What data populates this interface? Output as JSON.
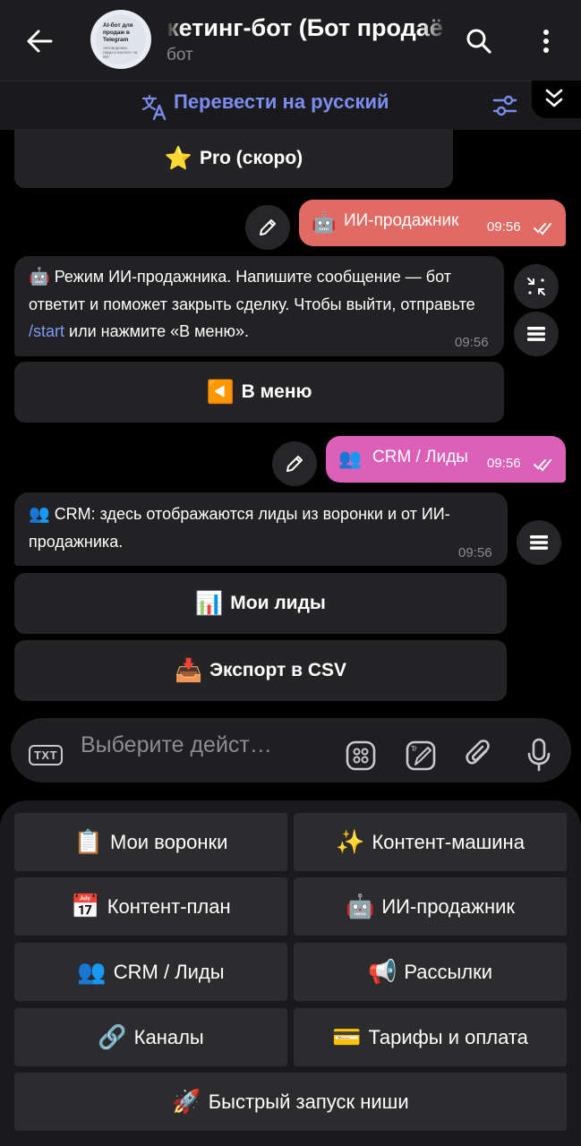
{
  "header": {
    "title": "кетинг-бот (Бот продаё",
    "subtitle": "бот",
    "avatar_text_1": "AI-бот для продаж в Telegram",
    "avatar_text_2": "Автоворонки, лиды и контент на ИИ"
  },
  "translate_bar": {
    "label": "Перевести на русский"
  },
  "messages": {
    "pro_button": {
      "emoji": "⭐",
      "label": "Pro (скоро)"
    },
    "out1": {
      "emoji": "🤖",
      "text": "ИИ-продажник",
      "time": "09:56"
    },
    "in1": {
      "emoji": "🤖",
      "text_before": "Режим ИИ-продажника. Напишите сообщение — бот ответит и поможет закрыть сделку. Чтобы выйти, отправьте ",
      "command": "/start",
      "text_after": " или нажмите «В меню».",
      "time": "09:56"
    },
    "menu_button": {
      "emoji": "◀️",
      "label": "В меню"
    },
    "out2": {
      "emoji": "👥",
      "text": "CRM / Лиды",
      "time": "09:56"
    },
    "in2": {
      "emoji": "👥",
      "text": "CRM: здесь отображаются лиды из воронки и от ИИ-продажника.",
      "time": "09:56"
    },
    "leads_button": {
      "emoji": "📊",
      "label": "Мои лиды"
    },
    "export_button": {
      "emoji": "📥",
      "label": "Экспорт в CSV"
    }
  },
  "input": {
    "placeholder": "Выберите дейст…",
    "txt_label": "TXT"
  },
  "keyboard": {
    "buttons": [
      {
        "emoji": "📋",
        "label": "Мои воронки"
      },
      {
        "emoji": "✨",
        "label": "Контент-машина"
      },
      {
        "emoji": "📅",
        "label": "Контент-план"
      },
      {
        "emoji": "🤖",
        "label": "ИИ-продажник"
      },
      {
        "emoji": "👥",
        "label": "CRM / Лиды"
      },
      {
        "emoji": "📢",
        "label": "Рассылки"
      },
      {
        "emoji": "🔗",
        "label": "Каналы"
      },
      {
        "emoji": "💳",
        "label": "Тарифы и оплата"
      },
      {
        "emoji": "🚀",
        "label": "Быстрый запуск ниши"
      }
    ]
  },
  "colors": {
    "accent": "#7b8cf0",
    "outgoing_red": "#e26a64",
    "outgoing_pink": "#dc60b8"
  }
}
